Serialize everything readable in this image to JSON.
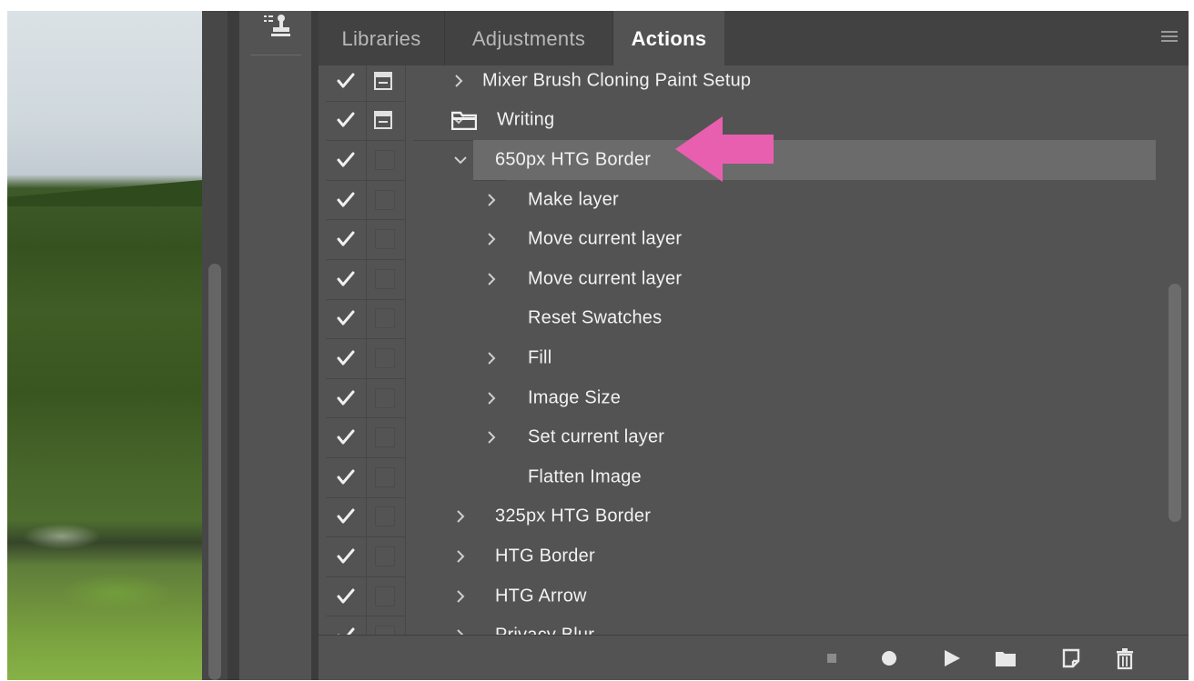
{
  "tabs": [
    {
      "label": "Libraries",
      "active": false
    },
    {
      "label": "Adjustments",
      "active": false
    },
    {
      "label": "Actions",
      "active": true
    }
  ],
  "actions": [
    {
      "name": "Mixer Brush Cloning Paint Setup",
      "checked": true,
      "dialog": "dialog-toggle-icon",
      "expand": "collapsed"
    },
    {
      "name": "Writing",
      "checked": true,
      "dialog": "dialog-toggle-icon",
      "expand": "expanded",
      "icon": "folder-icon"
    },
    {
      "name": "650px HTG Border",
      "checked": true,
      "dialog": "",
      "expand": "expanded",
      "selected": true
    },
    {
      "name": "Make layer",
      "checked": true,
      "dialog": "",
      "expand": "collapsed"
    },
    {
      "name": "Move current layer",
      "checked": true,
      "dialog": "",
      "expand": "collapsed"
    },
    {
      "name": "Move current layer",
      "checked": true,
      "dialog": "",
      "expand": "collapsed"
    },
    {
      "name": "Reset Swatches",
      "checked": true,
      "dialog": "",
      "expand": "none"
    },
    {
      "name": "Fill",
      "checked": true,
      "dialog": "",
      "expand": "collapsed"
    },
    {
      "name": "Image Size",
      "checked": true,
      "dialog": "",
      "expand": "collapsed"
    },
    {
      "name": "Set current layer",
      "checked": true,
      "dialog": "",
      "expand": "collapsed"
    },
    {
      "name": "Flatten Image",
      "checked": true,
      "dialog": "",
      "expand": "none"
    },
    {
      "name": "325px HTG Border",
      "checked": true,
      "dialog": "",
      "expand": "collapsed"
    },
    {
      "name": "HTG Border",
      "checked": true,
      "dialog": "",
      "expand": "collapsed"
    },
    {
      "name": "HTG Arrow",
      "checked": true,
      "dialog": "",
      "expand": "collapsed"
    },
    {
      "name": "Privacy Blur",
      "checked": true,
      "dialog": "",
      "expand": "collapsed"
    }
  ],
  "footer_buttons": [
    {
      "name": "stop-icon",
      "label": "Stop playing/recording"
    },
    {
      "name": "record-icon",
      "label": "Begin recording"
    },
    {
      "name": "play-icon",
      "label": "Play selection"
    },
    {
      "name": "new-set-icon",
      "label": "Create new set"
    },
    {
      "name": "new-action-icon",
      "label": "Create new action"
    },
    {
      "name": "trash-icon",
      "label": "Delete"
    }
  ],
  "colors": {
    "panel_bg": "#535353",
    "selected_row": "#6b6b6b",
    "annotation_arrow": "#e95fb0"
  }
}
